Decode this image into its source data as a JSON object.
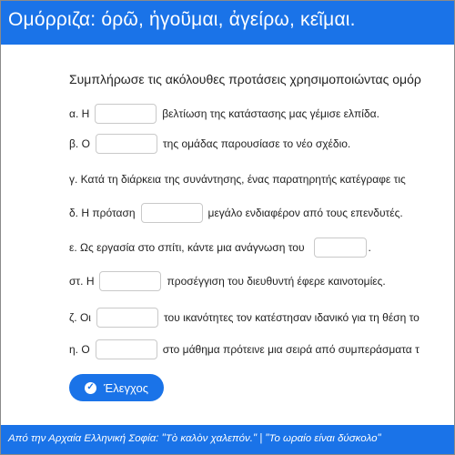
{
  "header": {
    "title": "Ομόρριζα: όρῶ, ἡγοῦμαι, ἀγείρω, κεῖμαι."
  },
  "exercise": {
    "instructions": "Συμπλήρωσε τις ακόλουθες προτάσεις χρησιμοποιώντας ομόρ",
    "sentences": [
      {
        "before": "α. Η",
        "after": "βελτίωση της κατάστασης μας γέμισε ελπίδα."
      },
      {
        "before": "β. Ο",
        "after": "της ομάδας παρουσίασε το νέο σχέδιο."
      },
      {
        "before": "γ. Κατά τη διάρκεια της συνάντησης, ένας παρατηρητής κατέγραφε τις",
        "after": ""
      },
      {
        "before": "δ. Η πρόταση",
        "after": "μεγάλο ενδιαφέρον από τους επενδυτές."
      },
      {
        "before": "ε. Ως εργασία στο σπίτι, κάντε μια ανάγνωση του",
        "after": "."
      },
      {
        "before": "στ. Η",
        "after": "προσέγγιση του διευθυντή έφερε καινοτομίες."
      },
      {
        "before": "ζ. Οι",
        "after": "του ικανότητες τον κατέστησαν ιδανικό για τη θέση το"
      },
      {
        "before": "η. Ο",
        "after": "στο μάθημα πρότεινε μια σειρά από συμπεράσματα τ"
      }
    ],
    "check_label": "Έλεγχος"
  },
  "footer": {
    "quote": "Από την Αρχαία Ελληνική Σοφία: \"Τὸ καλὸν χαλεπόν.\" | \"Το ωραίο είναι δύσκολο\""
  }
}
